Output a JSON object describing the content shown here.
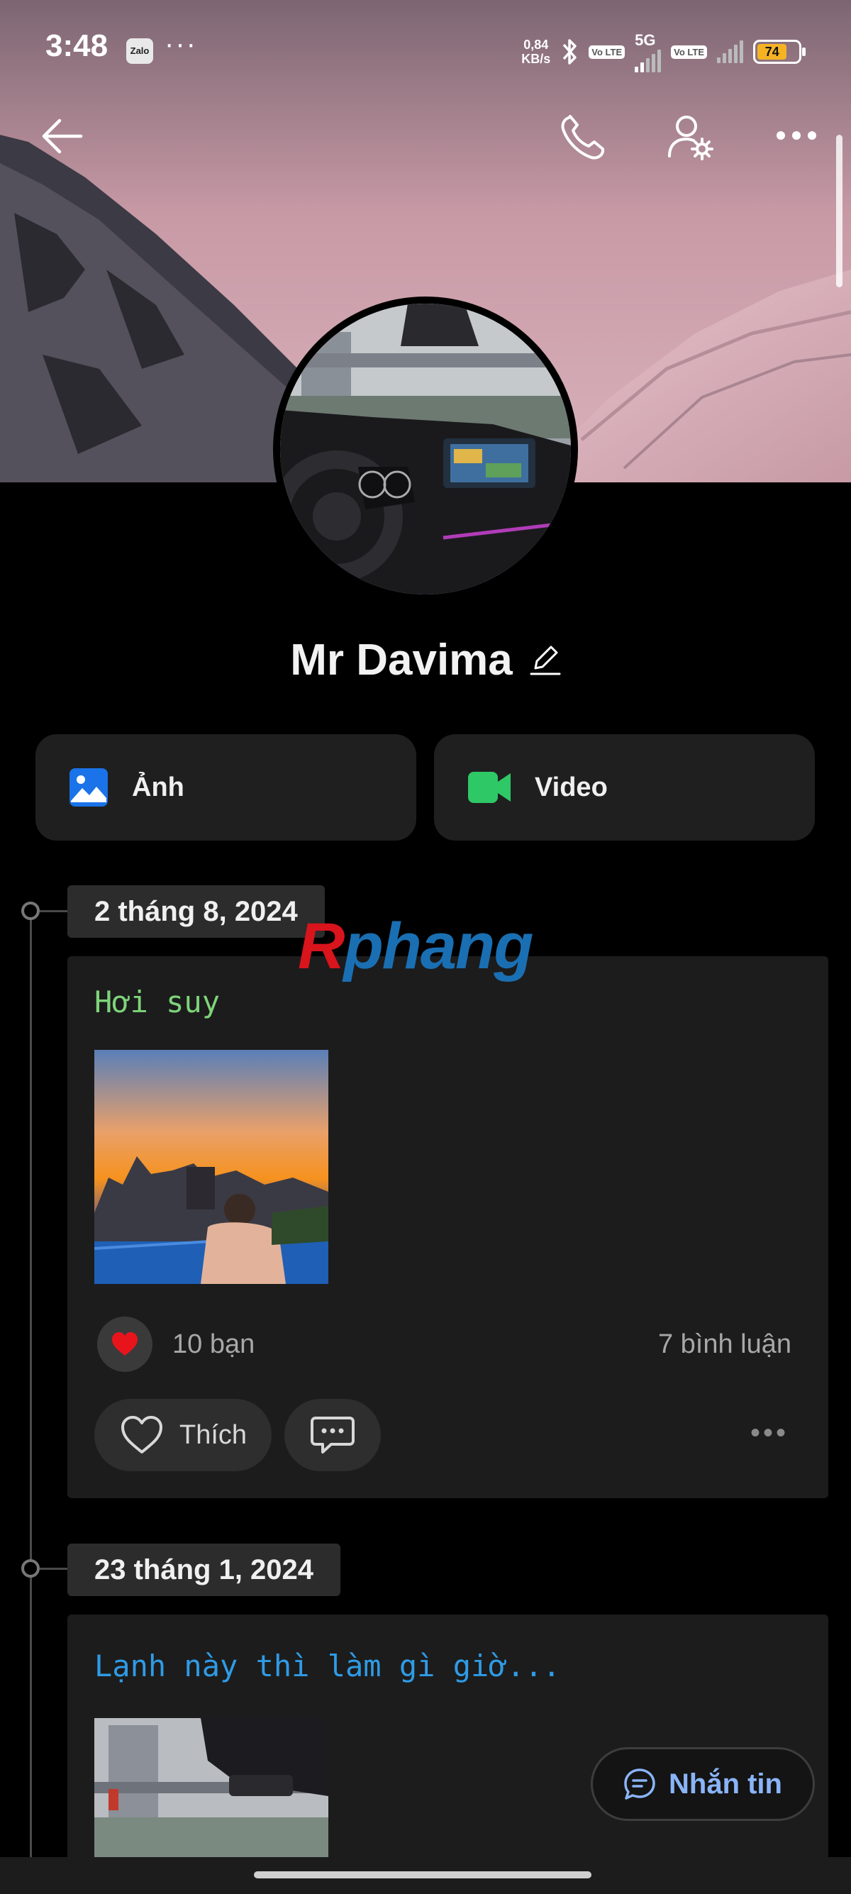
{
  "status_bar": {
    "time": "3:48",
    "zalo_label": "Zalo",
    "more_indicator": "···",
    "net_speed_value": "0,84",
    "net_speed_unit": "KB/s",
    "volte1": "Vo LTE",
    "network_5g": "5G",
    "volte2": "Vo LTE",
    "battery_level": "74"
  },
  "profile": {
    "name": "Mr Davima"
  },
  "media_buttons": {
    "photos_label": "Ảnh",
    "video_label": "Video"
  },
  "timeline": [
    {
      "date": "2 tháng 8, 2024",
      "text": "Hơi suy",
      "text_color": "#7ed47a",
      "reaction_count": "10 bạn",
      "comment_count": "7 bình luận",
      "like_label": "Thích"
    },
    {
      "date": "23 tháng 1, 2024",
      "text": "Lạnh này thì làm gì giờ...",
      "text_color": "#2f9be6"
    }
  ],
  "watermark": {
    "part1": "R",
    "part2": "phang"
  },
  "message_button": {
    "label": "Nhắn tin"
  },
  "colors": {
    "accent_blue": "#8ab4f8",
    "photo_icon": "#1a73e8",
    "video_icon": "#2ec866",
    "heart": "#e8141c"
  }
}
